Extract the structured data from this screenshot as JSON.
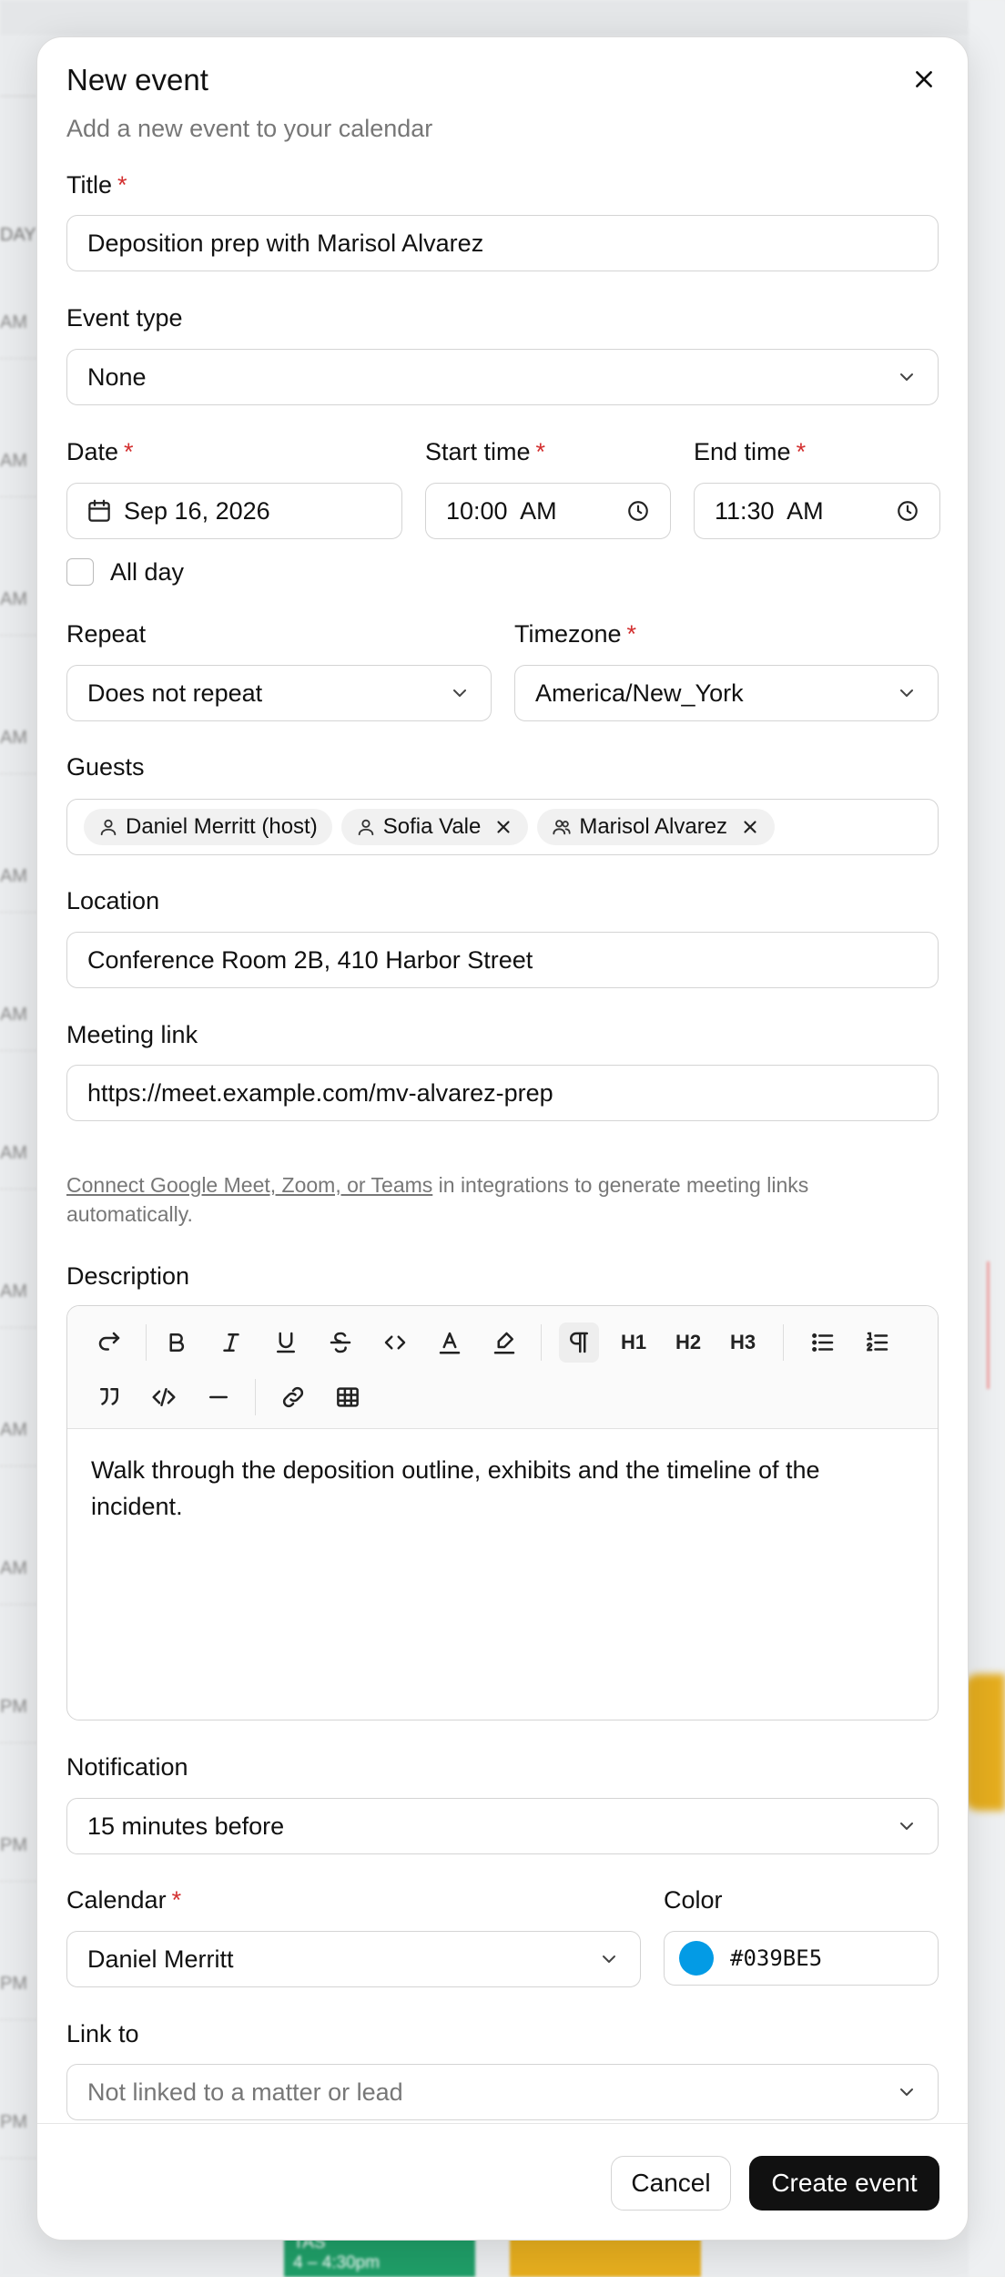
{
  "background": {
    "day_header": "DAY",
    "time_slots": [
      "AM",
      "AM",
      "AM",
      "AM",
      "AM",
      "AM",
      "AM",
      "AM",
      "AM",
      "AM",
      "PM",
      "PM",
      "PM",
      "PM"
    ],
    "event_label": "TAS",
    "event_time": "4 – 4:30pm"
  },
  "modal": {
    "title": "New event",
    "subtitle": "Add a new event to your calendar",
    "title_label": "Title",
    "title_value": "Deposition prep with Marisol Alvarez",
    "event_type_label": "Event type",
    "event_type_value": "None",
    "date_label": "Date",
    "date_value": "Sep 16, 2026",
    "start_label": "Start time",
    "start_value": "10:00  AM",
    "end_label": "End time",
    "end_value": "11:30  AM",
    "all_day_label": "All day",
    "repeat_label": "Repeat",
    "repeat_value": "Does not repeat",
    "timezone_label": "Timezone",
    "timezone_value": "America/New_York",
    "guests_label": "Guests",
    "guests": [
      {
        "name": "Daniel Merritt (host)",
        "removable": false,
        "icon": "user-icon"
      },
      {
        "name": "Sofia Vale",
        "removable": true,
        "icon": "user-icon"
      },
      {
        "name": "Marisol Alvarez",
        "removable": true,
        "icon": "users-icon"
      }
    ],
    "location_label": "Location",
    "location_value": "Conference Room 2B, 410 Harbor Street",
    "meeting_label": "Meeting link",
    "meeting_value": "https://meet.example.com/mv-alvarez-prep",
    "meeting_help_link": "Connect Google Meet, Zoom, or Teams",
    "meeting_help_text": " in integrations to generate meeting links automatically.",
    "description_label": "Description",
    "description_text": "Walk through the deposition outline, exhibits and the timeline of the incident.",
    "toolbar": {
      "h1": "H1",
      "h2": "H2",
      "h3": "H3"
    },
    "notification_label": "Notification",
    "notification_value": "15 minutes before",
    "calendar_label": "Calendar",
    "calendar_value": "Daniel Merritt",
    "color_label": "Color",
    "color_value": "#039BE5",
    "link_label": "Link to",
    "link_placeholder": "Not linked to a matter or lead",
    "cancel_label": "Cancel",
    "create_label": "Create event",
    "required_mark": "*"
  },
  "colors": {
    "accent": "#039BE5",
    "required": "#d32f2f",
    "primary_button": "#111111"
  }
}
